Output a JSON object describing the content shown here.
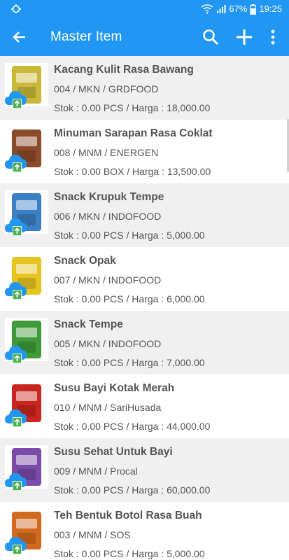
{
  "status_bar": {
    "battery": "67%",
    "time": "19:25"
  },
  "app_bar": {
    "title": "Master Item",
    "back_icon": "arrow-back-icon",
    "actions": [
      "search-icon",
      "add-icon",
      "more-vert-icon"
    ]
  },
  "colors": {
    "primary": "#2196f3",
    "row_alt": "#f0f0f0",
    "cloud": "#2196f3",
    "upload_arrow": "#4caf50"
  },
  "items": [
    {
      "name": "Kacang Kulit Rasa Bawang",
      "code": "004 / MKN / GRDFOOD",
      "stock": "Stok : 0.00 PCS / Harga : 18,000.00",
      "thumb_color": "#c9b83a"
    },
    {
      "name": "Minuman Sarapan Rasa Coklat",
      "code": "008 / MNM / ENERGEN",
      "stock": "Stok : 0.00 BOX / Harga : 13,500.00",
      "thumb_color": "#8b4a2a"
    },
    {
      "name": "Snack Krupuk Tempe",
      "code": "006 / MKN / INDOFOOD",
      "stock": "Stok : 0.00 PCS / Harga : 5,000.00",
      "thumb_color": "#3b7fc4"
    },
    {
      "name": "Snack Opak",
      "code": "007 / MKN / INDOFOOD",
      "stock": "Stok : 0.00 PCS / Harga : 6,000.00",
      "thumb_color": "#e6c420"
    },
    {
      "name": "Snack Tempe",
      "code": "005 / MKN / INDOFOOD",
      "stock": "Stok : 0.00 PCS / Harga : 7,000.00",
      "thumb_color": "#3f9a3a"
    },
    {
      "name": "Susu Bayi Kotak Merah",
      "code": "010 / MNM / SariHusada",
      "stock": "Stok : 0.00 PCS / Harga : 44,000.00",
      "thumb_color": "#c8261e"
    },
    {
      "name": "Susu Sehat Untuk Bayi",
      "code": "009 / MNM / Procal",
      "stock": "Stok : 0.00 PCS / Harga : 60,000.00",
      "thumb_color": "#7a4ba8"
    },
    {
      "name": "Teh Bentuk Botol Rasa Buah",
      "code": "003 / MNM / SOS",
      "stock": "Stok : 0.00 PCS / Harga : 5,000.00",
      "thumb_color": "#d2691e"
    }
  ]
}
